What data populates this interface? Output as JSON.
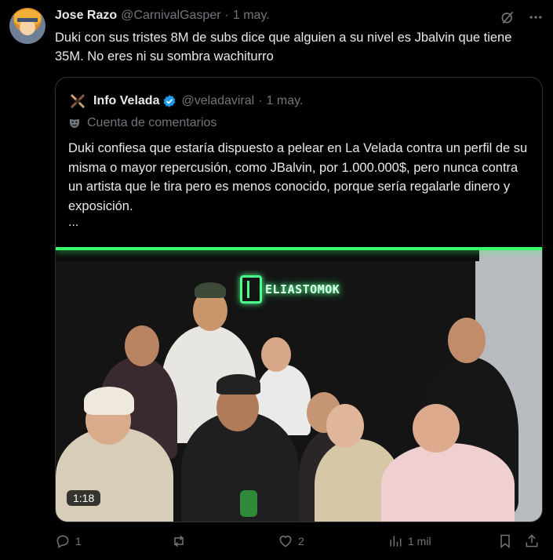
{
  "tweet": {
    "author_name": "Jose Razo",
    "handle": "@CarnivalGasper",
    "separator": "·",
    "date": "1 may.",
    "text": "Duki con sus tristes 8M de subs dice que alguien a su nivel es Jbalvin que tiene 35M. No eres ni su sombra wachiturro"
  },
  "quoted": {
    "author_name": "Info Velada",
    "handle": "@veladaviral",
    "separator": "·",
    "date": "1 may.",
    "account_label": "Cuenta de comentarios",
    "text": "Duki confiesa que estaría dispuesto a pelear en La Velada contra un perfil de su misma o mayor repercusión, como JBalvin, por 1.000.000$, pero nunca contra un artista que le tira pero es menos conocido, porque sería regalarle dinero y exposición.",
    "ellipsis": "...",
    "video": {
      "neon_sign": "ELIASTOMOK",
      "duration": "1:18"
    }
  },
  "actions": {
    "replies": "1",
    "reposts": "",
    "likes": "2",
    "views": "1 mil"
  },
  "colors": {
    "background": "#000000",
    "text_primary": "#e7e9ea",
    "text_secondary": "#71767b",
    "verified": "#1d9bf0",
    "neon": "#4bff8b"
  },
  "icons": [
    "grok-icon",
    "more-icon",
    "verified-icon",
    "comment-mask-icon",
    "reply-icon",
    "repost-icon",
    "like-icon",
    "views-icon",
    "bookmark-icon",
    "share-icon"
  ]
}
